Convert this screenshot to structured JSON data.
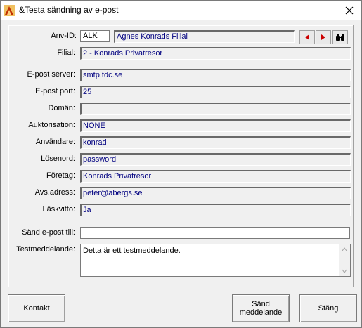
{
  "window": {
    "title": "&Testa sändning av e-post"
  },
  "form": {
    "anv_id": {
      "label": "Anv-ID:",
      "code": "ALK",
      "name": "Agnes Konrads Filial"
    },
    "filial": {
      "label": "Filial:",
      "value": "2 - Konrads Privatresor"
    },
    "server": {
      "label": "E-post server:",
      "value": "smtp.tdc.se"
    },
    "port": {
      "label": "E-post port:",
      "value": "25"
    },
    "doman": {
      "label": "Domän:",
      "value": ""
    },
    "auth": {
      "label": "Auktorisation:",
      "value": "NONE"
    },
    "user": {
      "label": "Användare:",
      "value": "konrad"
    },
    "password": {
      "label": "Lösenord:",
      "value": "password"
    },
    "company": {
      "label": "Företag:",
      "value": "Konrads Privatresor"
    },
    "sender": {
      "label": "Avs.adress:",
      "value": "peter@abergs.se"
    },
    "receipt": {
      "label": "Läskvitto:",
      "value": "Ja"
    },
    "send_to": {
      "label": "Sänd e-post till:",
      "value": ""
    },
    "message": {
      "label": "Testmeddelande:",
      "value": "Detta är ett testmeddelande."
    }
  },
  "buttons": {
    "contact": "Kontakt",
    "send_line1": "Sänd",
    "send_line2": "meddelande",
    "close": "Stäng"
  },
  "colors": {
    "field_text": "#000080",
    "nav_arrow": "#cc0000"
  },
  "icons": {
    "prev": "arrow-left-icon",
    "next": "arrow-right-icon",
    "search": "binoculars-icon"
  }
}
